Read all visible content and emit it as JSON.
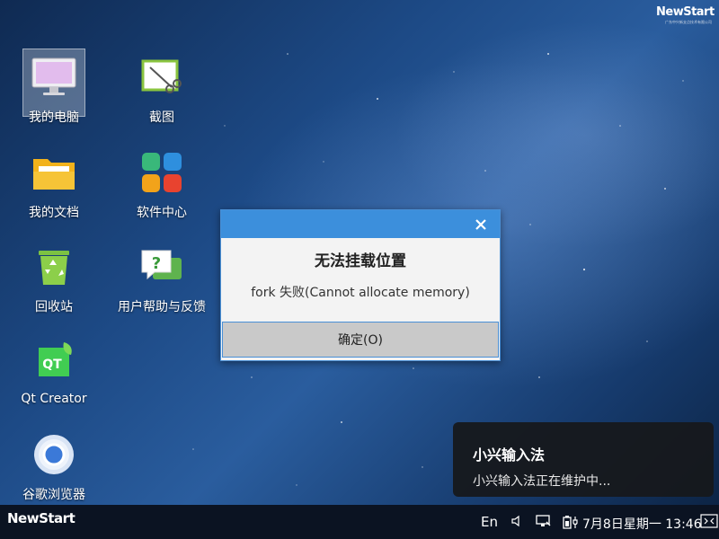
{
  "brand": {
    "name": "NewStart",
    "subtitle": "广东中兴新支点技术有限公司"
  },
  "desktop": {
    "icons": [
      {
        "label": "我的电脑",
        "icon": "computer-icon"
      },
      {
        "label": "截图",
        "icon": "screenshot-icon"
      },
      {
        "label": "我的文档",
        "icon": "folder-icon"
      },
      {
        "label": "软件中心",
        "icon": "software-center-icon"
      },
      {
        "label": "回收站",
        "icon": "recycle-bin-icon"
      },
      {
        "label": "用户帮助与反馈",
        "icon": "help-icon"
      },
      {
        "label": "Qt Creator",
        "icon": "qt-creator-icon"
      },
      {
        "label": "谷歌浏览器",
        "icon": "chrome-icon"
      }
    ]
  },
  "dialog": {
    "title": "无法挂载位置",
    "message": "fork 失败(Cannot allocate memory)",
    "ok_label": "确定(O)",
    "accent": "#3c8fdc"
  },
  "notification": {
    "title": "小兴输入法",
    "body": "小兴输入法正在维护中..."
  },
  "taskbar": {
    "logo": "NewStart",
    "lang": "En",
    "clock": "7月8日星期一 13:46",
    "icons": [
      "volume-icon",
      "network-icon",
      "battery-icon",
      "show-desktop-icon"
    ]
  }
}
